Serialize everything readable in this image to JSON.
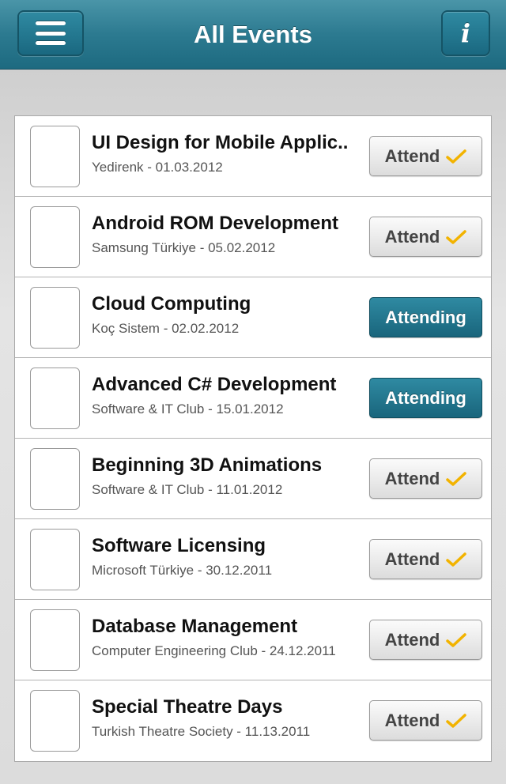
{
  "header": {
    "title": "All Events",
    "menu_icon": "hamburger-menu-icon",
    "info_icon": "info-icon",
    "info_glyph": "i"
  },
  "colors": {
    "accent": "#1d6a80",
    "check": "#f2b300"
  },
  "events": [
    {
      "title": "UI Design for Mobile Applic..",
      "subtitle": "Yedirenk - 01.03.2012",
      "button": "Attend",
      "state": "attend"
    },
    {
      "title": "Android ROM Development",
      "subtitle": "Samsung Türkiye - 05.02.2012",
      "button": "Attend",
      "state": "attend"
    },
    {
      "title": "Cloud Computing",
      "subtitle": "Koç Sistem - 02.02.2012",
      "button": "Attending",
      "state": "attending"
    },
    {
      "title": "Advanced C# Development",
      "subtitle": "Software & IT Club - 15.01.2012",
      "button": "Attending",
      "state": "attending"
    },
    {
      "title": "Beginning 3D Animations",
      "subtitle": "Software & IT Club - 11.01.2012",
      "button": "Attend",
      "state": "attend"
    },
    {
      "title": "Software Licensing",
      "subtitle": "Microsoft Türkiye - 30.12.2011",
      "button": "Attend",
      "state": "attend"
    },
    {
      "title": "Database Management",
      "subtitle": "Computer Engineering Club - 24.12.2011",
      "button": "Attend",
      "state": "attend"
    },
    {
      "title": "Special Theatre Days",
      "subtitle": "Turkish Theatre Society - 11.13.2011",
      "button": "Attend",
      "state": "attend"
    }
  ]
}
